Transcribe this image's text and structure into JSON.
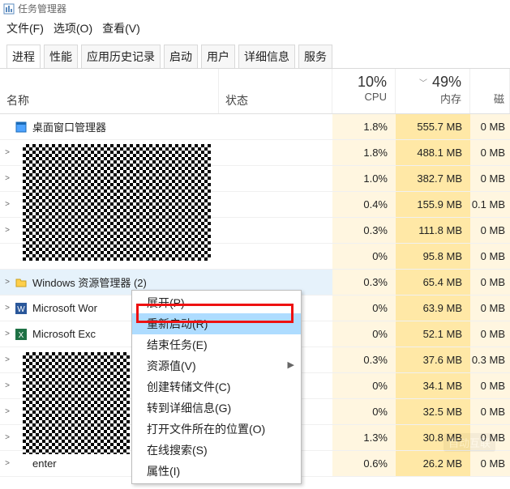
{
  "window": {
    "title": "任务管理器"
  },
  "menubar": [
    "文件(F)",
    "选项(O)",
    "查看(V)"
  ],
  "tabs": [
    {
      "label": "进程",
      "active": true
    },
    {
      "label": "性能"
    },
    {
      "label": "应用历史记录"
    },
    {
      "label": "启动"
    },
    {
      "label": "用户"
    },
    {
      "label": "详细信息"
    },
    {
      "label": "服务"
    }
  ],
  "columns": {
    "name": "名称",
    "status": "状态",
    "cpu_pct": "10%",
    "cpu_label": "CPU",
    "mem_pct": "49%",
    "mem_label": "内存",
    "disk_label": "磁"
  },
  "processes": [
    {
      "expand": "",
      "icon": "window-blue",
      "name": "桌面窗口管理器",
      "cpu": "1.8%",
      "mem": "555.7 MB",
      "disk": "0 MB"
    },
    {
      "expand": ">",
      "icon": "",
      "name": "",
      "cpu": "1.8%",
      "mem": "488.1 MB",
      "disk": "0 MB"
    },
    {
      "expand": ">",
      "icon": "",
      "name": "",
      "cpu": "1.0%",
      "mem": "382.7 MB",
      "disk": "0 MB"
    },
    {
      "expand": ">",
      "icon": "",
      "name": "",
      "cpu": "0.4%",
      "mem": "155.9 MB",
      "disk": "0.1 MB"
    },
    {
      "expand": ">",
      "icon": "",
      "name": "",
      "cpu": "0.3%",
      "mem": "111.8 MB",
      "disk": "0 MB"
    },
    {
      "expand": "",
      "icon": "",
      "name": "",
      "cpu": "0%",
      "mem": "95.8 MB",
      "disk": "0 MB"
    },
    {
      "expand": ">",
      "icon": "folder-yellow",
      "name": "Windows 资源管理器 (2)",
      "cpu": "0.3%",
      "mem": "65.4 MB",
      "disk": "0 MB",
      "selected": true
    },
    {
      "expand": ">",
      "icon": "word-blue",
      "name": "Microsoft Wor",
      "cpu": "0%",
      "mem": "63.9 MB",
      "disk": "0 MB"
    },
    {
      "expand": ">",
      "icon": "excel-green",
      "name": "Microsoft Exc",
      "cpu": "0%",
      "mem": "52.1 MB",
      "disk": "0 MB"
    },
    {
      "expand": ">",
      "icon": "",
      "name": "",
      "cpu": "0.3%",
      "mem": "37.6 MB",
      "disk": "0.3 MB"
    },
    {
      "expand": ">",
      "icon": "",
      "name": "",
      "cpu": "0%",
      "mem": "34.1 MB",
      "disk": "0 MB"
    },
    {
      "expand": ">",
      "icon": "",
      "name": "",
      "cpu": "0%",
      "mem": "32.5 MB",
      "disk": "0 MB"
    },
    {
      "expand": ">",
      "icon": "",
      "name": "",
      "cpu": "1.3%",
      "mem": "30.8 MB",
      "disk": "0 MB"
    },
    {
      "expand": ">",
      "icon": "",
      "name": "enter",
      "cpu": "0.6%",
      "mem": "26.2 MB",
      "disk": "0 MB"
    }
  ],
  "context_menu": [
    {
      "label": "展开(P)"
    },
    {
      "label": "重新启动(R)",
      "highlighted": true
    },
    {
      "label": "结束任务(E)"
    },
    {
      "label": "资源值(V)",
      "submenu": true
    },
    {
      "label": "创建转储文件(C)"
    },
    {
      "label": "转到详细信息(G)"
    },
    {
      "label": "打开文件所在的位置(O)"
    },
    {
      "label": "在线搜索(S)"
    },
    {
      "label": "属性(I)"
    }
  ],
  "watermark": "自动互联"
}
